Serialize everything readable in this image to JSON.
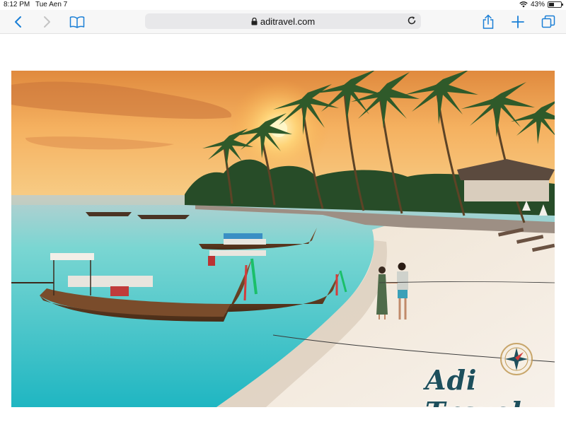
{
  "status": {
    "time": "8:12 PM",
    "date": "Tue Aen 7",
    "battery": "43%",
    "battery_level": 0.43
  },
  "browser": {
    "url": "aditravel.com"
  },
  "hero": {
    "brand": "Adi Travel"
  },
  "colors": {
    "accent": "#1a7fd6",
    "brand": "#1d4f5c",
    "sea": "#35c3c6",
    "sky": "#f2a14a"
  }
}
